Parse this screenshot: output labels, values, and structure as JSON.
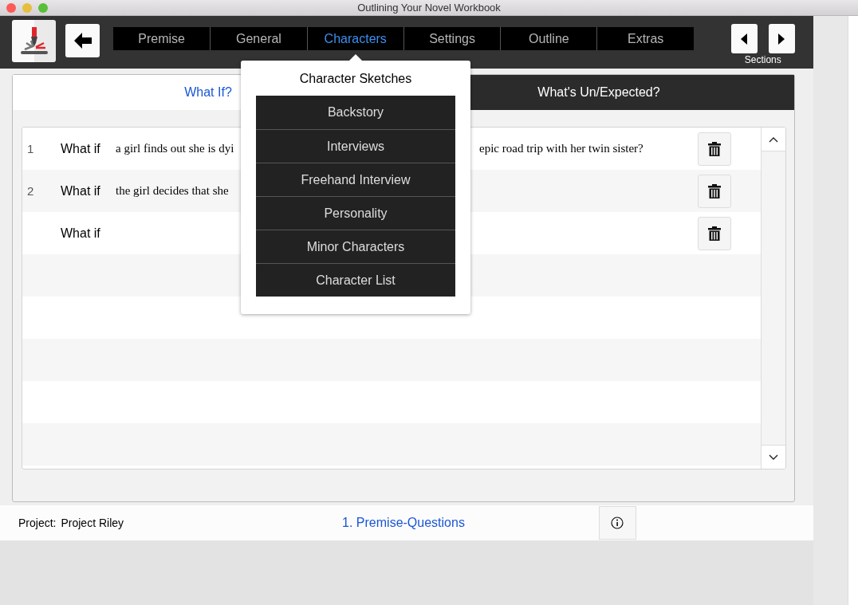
{
  "window": {
    "title": "Outlining Your Novel Workbook"
  },
  "nav": {
    "tabs": [
      {
        "label": "Premise",
        "selected": false
      },
      {
        "label": "General",
        "selected": false
      },
      {
        "label": "Characters",
        "selected": true
      },
      {
        "label": "Settings",
        "selected": false
      },
      {
        "label": "Outline",
        "selected": false
      },
      {
        "label": "Extras",
        "selected": false
      }
    ],
    "sections_label": "Sections"
  },
  "menu": {
    "title": "Character Sketches",
    "items": [
      "Backstory",
      "Interviews",
      "Freehand Interview",
      "Personality",
      "Minor Characters",
      "Character List"
    ]
  },
  "panel": {
    "tabs": [
      {
        "label": "What If?",
        "selected": true
      },
      {
        "label": "What's Un/Expected?",
        "selected": false
      }
    ],
    "rows": [
      {
        "number": "1",
        "prefix": "What if",
        "text_left": "a girl finds out she is dyi",
        "text_right": "epic road trip with her twin sister?"
      },
      {
        "number": "2",
        "prefix": "What if",
        "text_left": "the girl decides that she"
      },
      {
        "prefix": "What if"
      }
    ]
  },
  "footer": {
    "project_label": "Project:",
    "project_name": "Project Riley",
    "link": "1. Premise-Questions"
  }
}
